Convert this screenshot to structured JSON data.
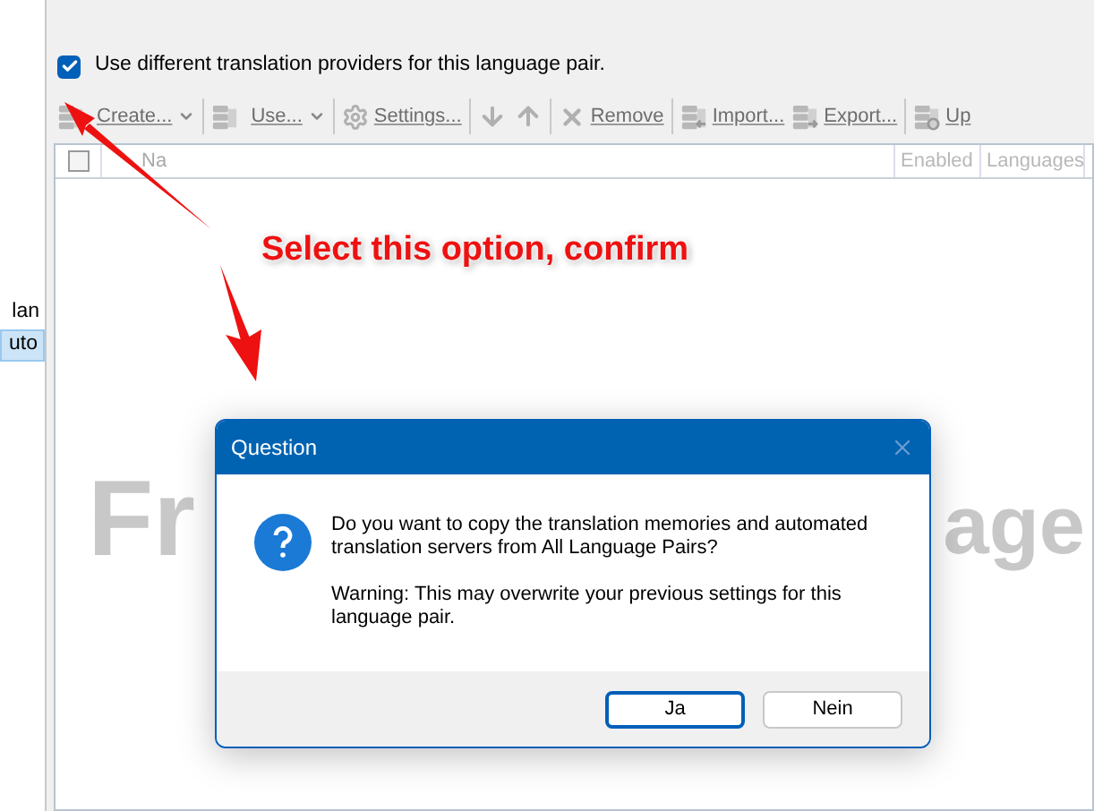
{
  "sidebar": {
    "items": [
      {
        "label": "lan",
        "selected": false
      },
      {
        "label": "uto",
        "selected": true
      }
    ]
  },
  "option": {
    "label": "Use different translation providers for this language pair.",
    "checked": true
  },
  "toolbar": [
    {
      "kind": "dropdown",
      "label": "Create..."
    },
    {
      "kind": "dropdown",
      "label": "Use..."
    },
    {
      "kind": "button",
      "label": "Settings..."
    },
    {
      "kind": "icon"
    },
    {
      "kind": "icon"
    },
    {
      "kind": "button",
      "label": "Remove"
    },
    {
      "kind": "button",
      "label": "Import..."
    },
    {
      "kind": "button",
      "label": "Export..."
    },
    {
      "kind": "button",
      "label": "Up"
    }
  ],
  "table": {
    "select_all_checked": false,
    "columns": [
      "Na",
      "Enabled",
      "Languages"
    ]
  },
  "background_text": [
    "Fr",
    "age"
  ],
  "annotation": "Select this option, confirm",
  "dialog": {
    "title": "Question",
    "message": "Do you want to copy the translation memories and automated translation servers from All Language Pairs?",
    "warning": "Warning: This may overwrite your previous settings for this language pair.",
    "buttons": [
      {
        "label": "Ja",
        "default": true
      },
      {
        "label": "Nein",
        "default": false
      }
    ]
  }
}
